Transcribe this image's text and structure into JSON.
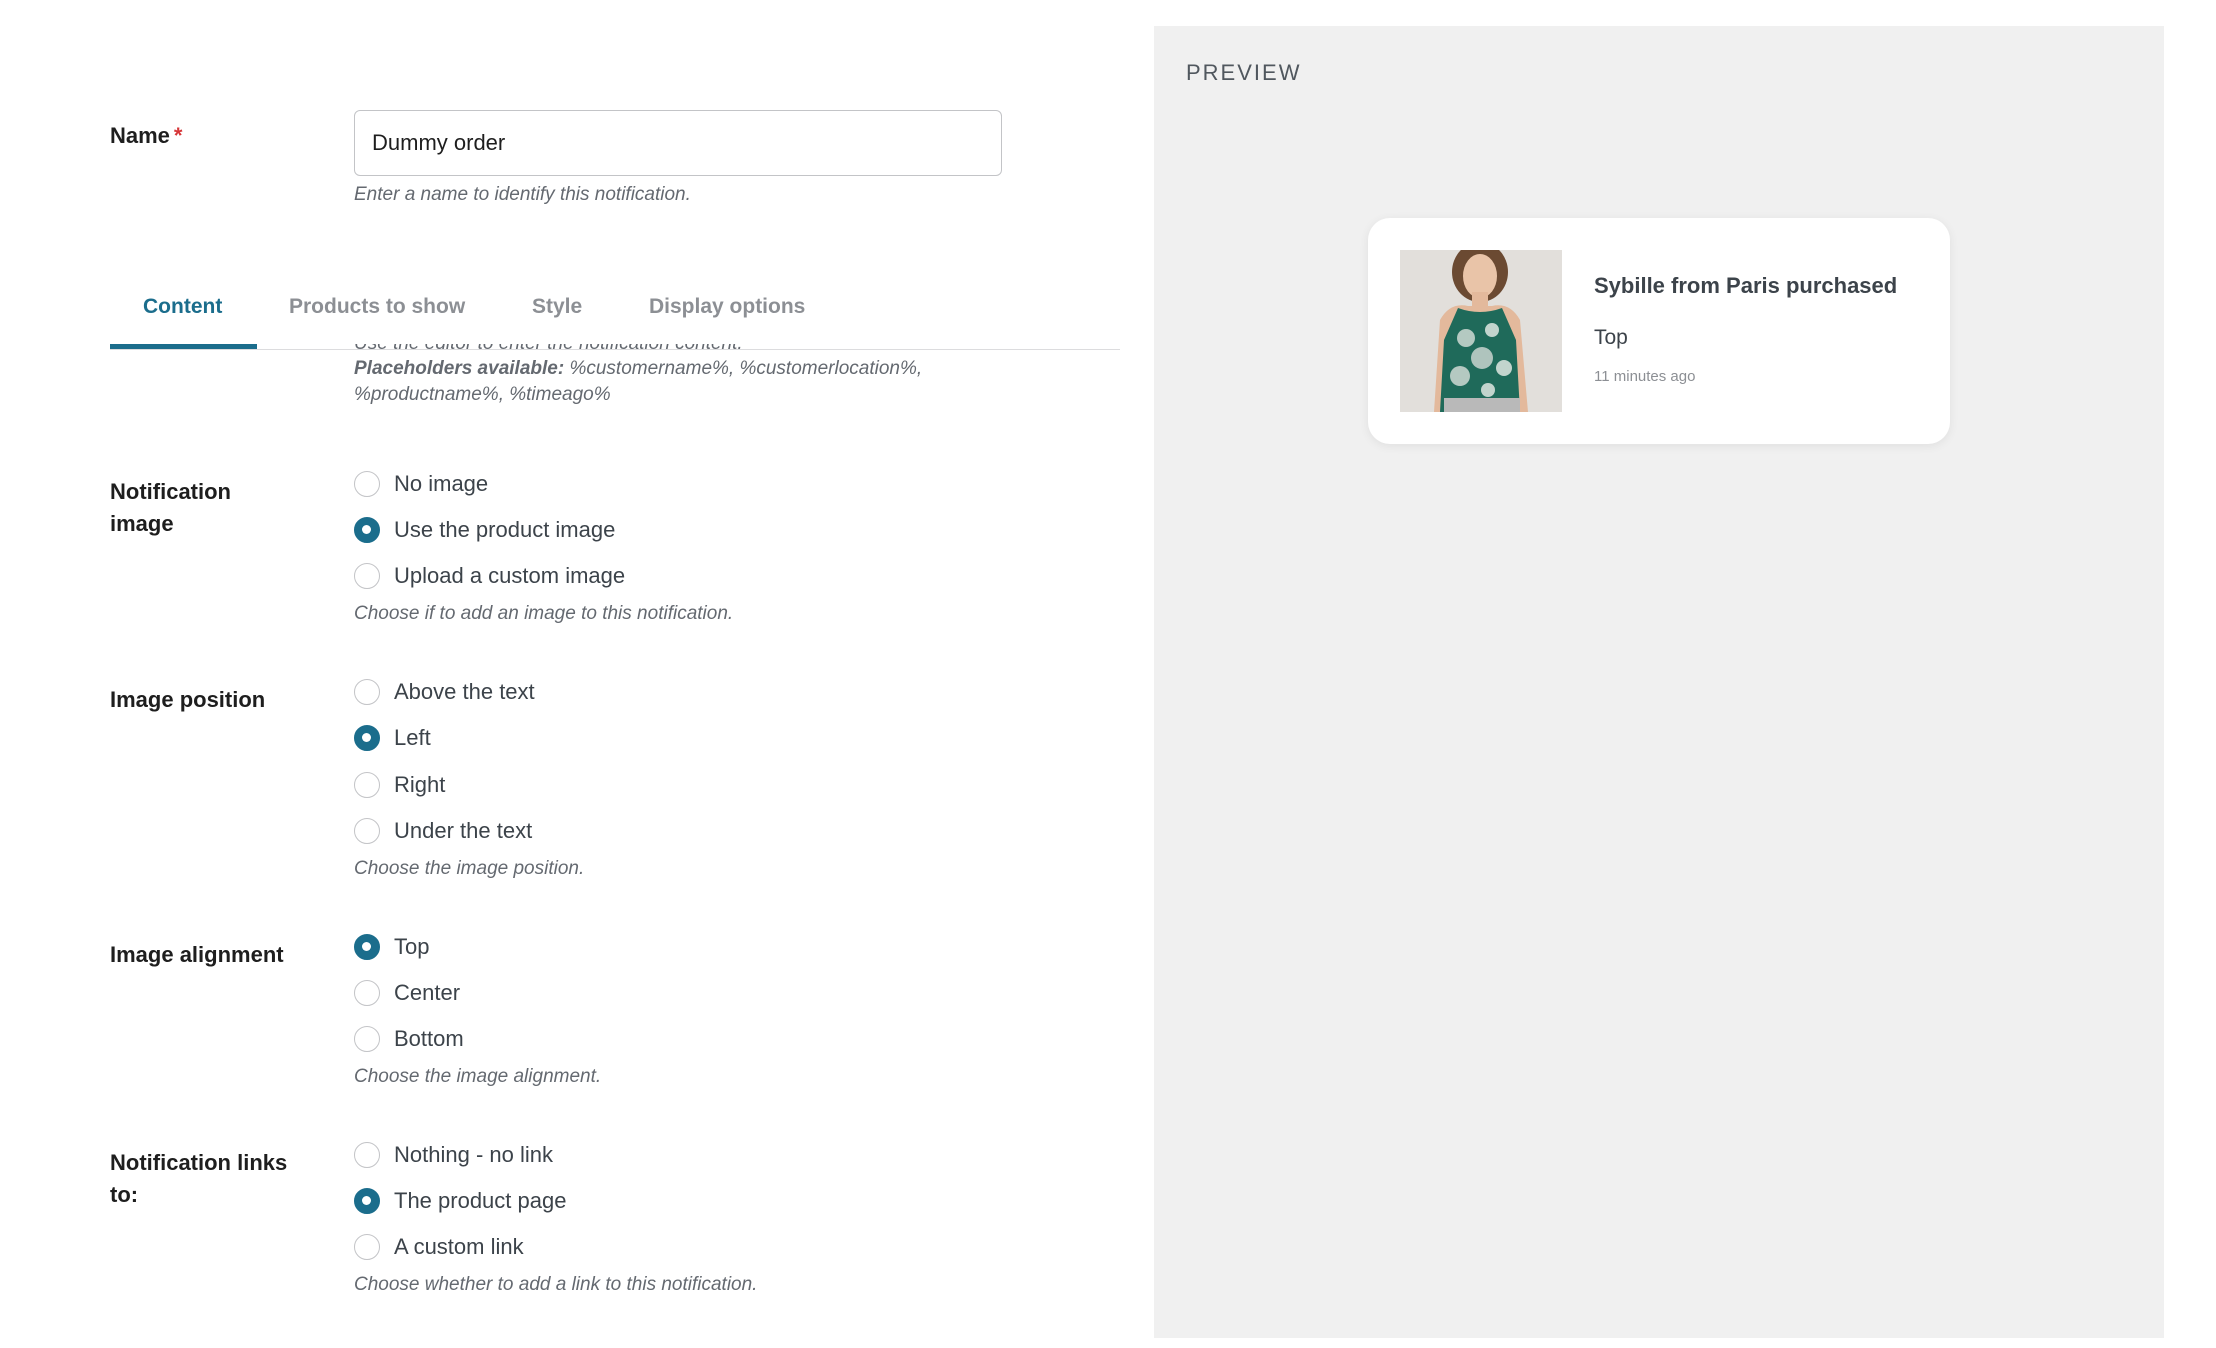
{
  "form": {
    "name": {
      "label": "Name",
      "required_mark": "*",
      "value": "Dummy order",
      "help": "Enter a name to identify this notification."
    },
    "tabs": [
      {
        "label": "Content",
        "active": true
      },
      {
        "label": "Products to show",
        "active": false
      },
      {
        "label": "Style",
        "active": false
      },
      {
        "label": "Display options",
        "active": false
      }
    ],
    "content_help": {
      "line1": "Use the editor to enter the notification content.",
      "placeholders_label": "Placeholders available:",
      "placeholders_line1": " %customername%, %customerlocation%,",
      "placeholders_line2": "%productname%, %timeago%"
    },
    "notification_image": {
      "label_line1": "Notification",
      "label_line2": "image",
      "options": [
        "No image",
        "Use the product image",
        "Upload a custom image"
      ],
      "selected": 1,
      "help": "Choose if to add an image to this notification."
    },
    "image_position": {
      "label": "Image position",
      "options": [
        "Above the text",
        "Left",
        "Right",
        "Under the text"
      ],
      "selected": 1,
      "help": "Choose the image position."
    },
    "image_alignment": {
      "label": "Image alignment",
      "options": [
        "Top",
        "Center",
        "Bottom"
      ],
      "selected": 0,
      "help": "Choose the image alignment."
    },
    "notification_links": {
      "label_line1": "Notification links",
      "label_line2": "to:",
      "options": [
        "Nothing - no link",
        "The product page",
        "A custom link"
      ],
      "selected": 1,
      "help": "Choose whether to add a link to this notification."
    }
  },
  "preview": {
    "title": "PREVIEW",
    "card": {
      "headline": "Sybille from Paris purchased",
      "product": "Top",
      "time_ago": "11 minutes ago",
      "image": "product-photo"
    }
  },
  "colors": {
    "accent": "#1b6d8c",
    "required": "#d63638",
    "preview_bg": "#f0f0f0"
  }
}
